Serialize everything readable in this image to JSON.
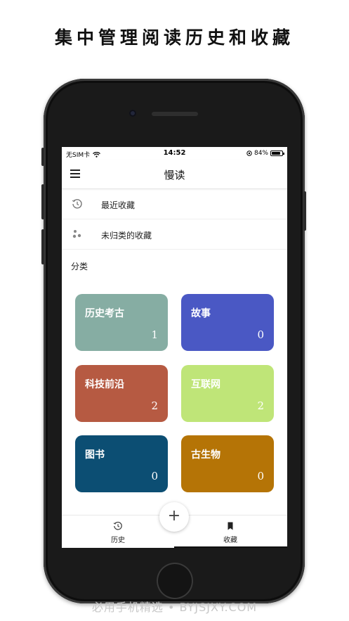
{
  "headline": "集中管理阅读历史和收藏",
  "status_bar": {
    "carrier": "无SIM卡",
    "time": "14:52",
    "battery_percent": "84%",
    "battery_level": 0.84
  },
  "nav": {
    "title": "慢读",
    "menu_icon": "hamburger-menu-icon"
  },
  "list": {
    "recent": {
      "icon": "history-clock-icon",
      "label": "最近收藏"
    },
    "uncategorized": {
      "icon": "dots-cluster-icon",
      "label": "未归类的收藏"
    }
  },
  "section_title": "分类",
  "categories": [
    {
      "name": "历史考古",
      "count": "1",
      "color": "#86ada3"
    },
    {
      "name": "故事",
      "count": "0",
      "color": "#4a58c4"
    },
    {
      "name": "科技前沿",
      "count": "2",
      "color": "#b65a42"
    },
    {
      "name": "互联网",
      "count": "2",
      "color": "#bfe578"
    },
    {
      "name": "图书",
      "count": "0",
      "color": "#0c4e73"
    },
    {
      "name": "古生物",
      "count": "0",
      "color": "#b57406"
    }
  ],
  "fab": {
    "label": "+"
  },
  "tabs": [
    {
      "label": "历史",
      "icon": "history-icon",
      "active": false
    },
    {
      "label": "收藏",
      "icon": "bookmark-icon",
      "active": true
    }
  ],
  "watermark": "必用手机精选 • BYJSJXY.COM"
}
